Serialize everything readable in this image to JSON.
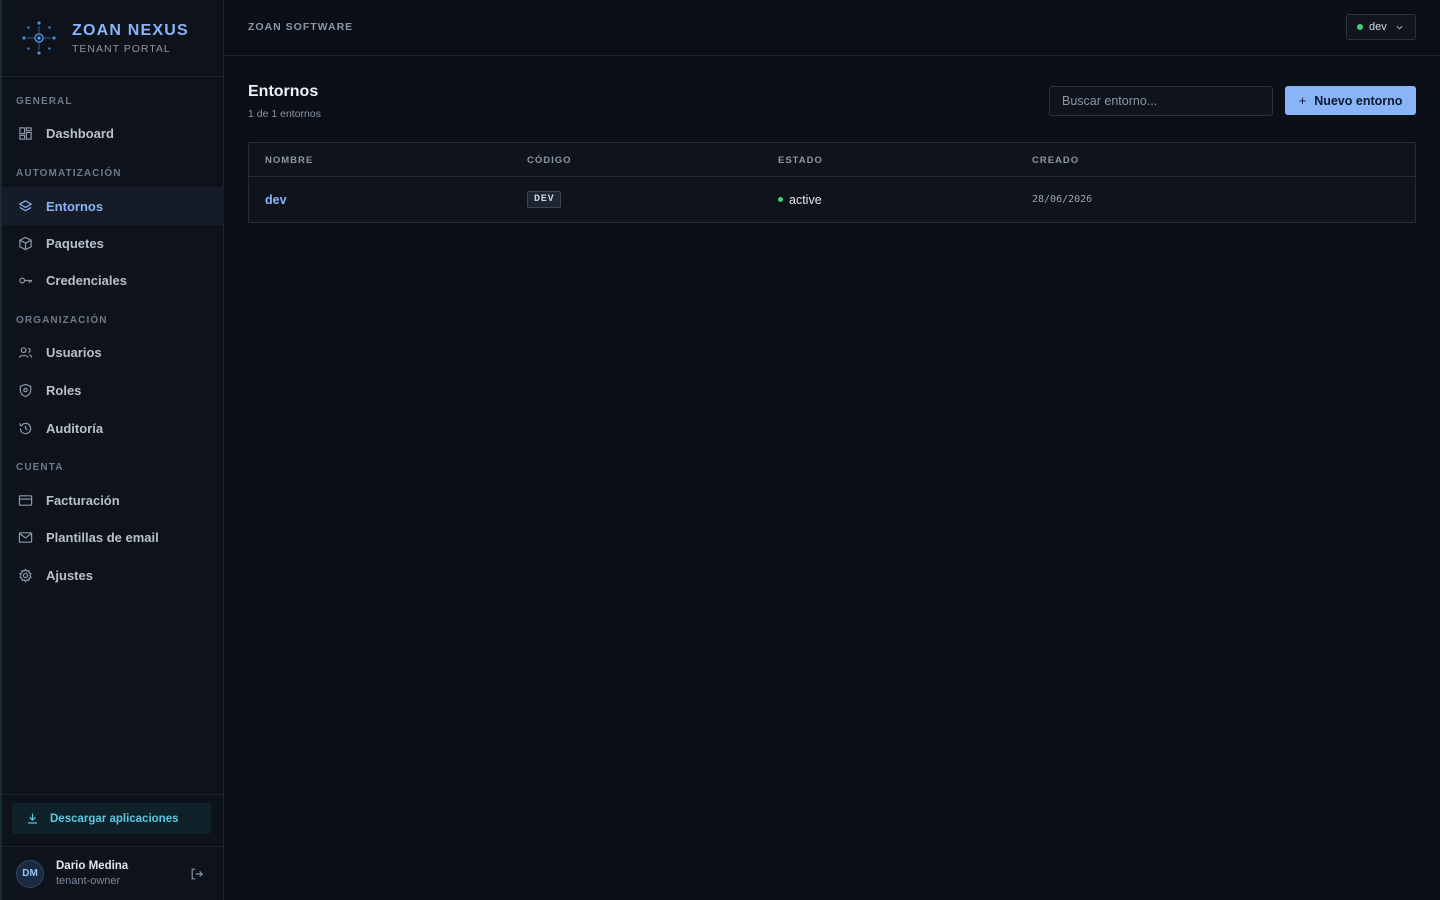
{
  "brand": {
    "name": "ZOAN NEXUS",
    "subtitle": "TENANT PORTAL",
    "logo_icon": "network-node-icon",
    "accent": "#8ab4f8"
  },
  "sidebar": {
    "sections": [
      {
        "label": "GENERAL"
      },
      {
        "label": "AUTOMATIZACIÓN"
      },
      {
        "label": "ORGANIZACIÓN"
      },
      {
        "label": "CUENTA"
      }
    ],
    "items": [
      {
        "label": "Dashboard",
        "icon": "grid-icon"
      },
      {
        "label": "Entornos",
        "icon": "layers-icon",
        "active": true
      },
      {
        "label": "Paquetes",
        "icon": "package-icon"
      },
      {
        "label": "Credenciales",
        "icon": "key-icon"
      },
      {
        "label": "Usuarios",
        "icon": "users-icon"
      },
      {
        "label": "Roles",
        "icon": "shield-icon"
      },
      {
        "label": "Auditoría",
        "icon": "history-icon"
      },
      {
        "label": "Facturación",
        "icon": "credit-card-icon"
      },
      {
        "label": "Plantillas de email",
        "icon": "mail-icon"
      },
      {
        "label": "Ajustes",
        "icon": "gear-icon"
      }
    ],
    "download_label": "Descargar aplicaciones",
    "user": {
      "initials": "DM",
      "name": "Dario Medina",
      "role": "tenant-owner"
    }
  },
  "topbar": {
    "company": "ZOAN SOFTWARE",
    "environment": "dev",
    "environment_status_color": "#3ecf7a"
  },
  "main": {
    "title": "Entornos",
    "subtitle": "1 de 1 entornos",
    "search_placeholder": "Buscar entorno...",
    "new_button_label": "Nuevo entorno",
    "table": {
      "headers": [
        "NOMBRE",
        "CÓDIGO",
        "ESTADO",
        "CREADO"
      ],
      "rows": [
        {
          "name": "dev",
          "code": "DEV",
          "status": "active",
          "created": "28/06/2026"
        }
      ]
    }
  }
}
